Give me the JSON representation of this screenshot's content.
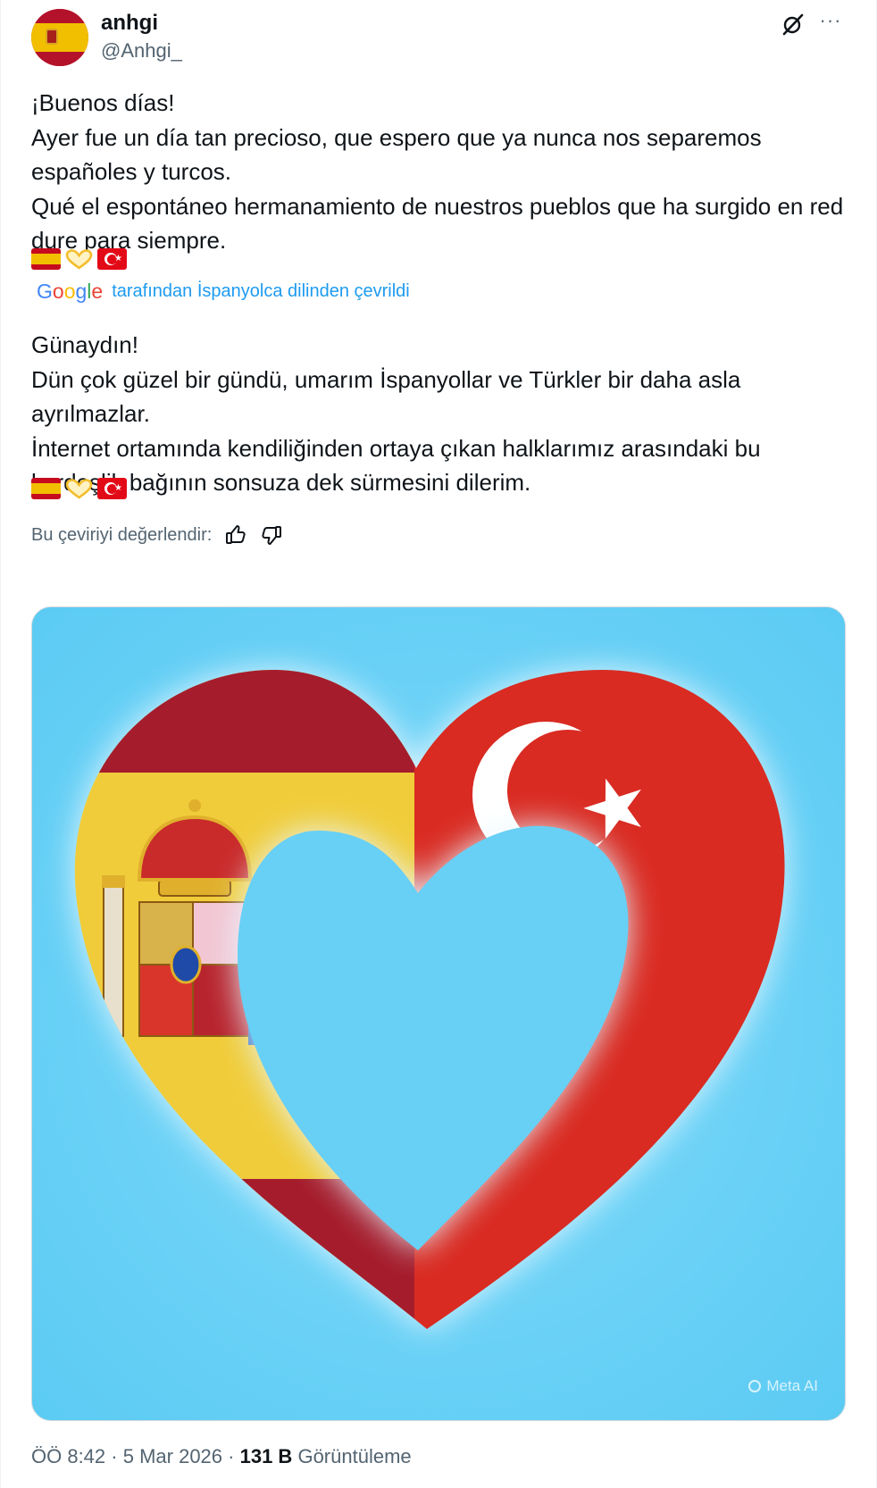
{
  "author": {
    "display_name": "anhgi",
    "handle": "@Anhgi_",
    "avatar_icon": "spain-flag-avatar"
  },
  "header_actions": {
    "grok_icon": "grok-icon",
    "more_icon": "more-options-icon",
    "more_label": "···"
  },
  "original_text": {
    "lines": [
      "¡Buenos días!",
      "Ayer fue un día tan precioso, que espero que ya nunca nos separemos españoles y turcos.",
      "Qué el espontáneo hermanamiento de nuestros pueblos que ha surgido en red dure para siempre."
    ],
    "emojis": [
      "spain-flag-emoji",
      "yellow-heart-hands-emoji",
      "turkey-flag-emoji"
    ]
  },
  "translation": {
    "provider": "Google",
    "notice": "tarafından İspanyolca dilinden çevrildi",
    "lines": [
      "Günaydın!",
      "Dün çok güzel bir gündü, umarım İspanyollar ve Türkler bir daha asla ayrılmazlar.",
      "İnternet ortamında kendiliğinden ortaya çıkan halklarımız arasındaki bu kardeşlik bağının sonsuza dek sürmesini dilerim."
    ]
  },
  "rating": {
    "label": "Bu çeviriyi değerlendir:",
    "thumbs_up_icon": "thumbs-up-icon",
    "thumbs_down_icon": "thumbs-down-icon"
  },
  "media": {
    "description_icon": "spain-turkey-heart-image",
    "watermark": "Meta AI",
    "colors": {
      "sky": "#6dd2f6",
      "spain_red": "#a51d2d",
      "spain_yellow": "#f0cc3a",
      "turkey_red": "#d92b22"
    }
  },
  "footer": {
    "time": "ÖÖ 8:42",
    "sep1": "·",
    "date": "5 Mar 2026",
    "sep2": "·",
    "views_count": "131 B",
    "views_label": "Görüntüleme"
  },
  "colors": {
    "accent": "#1d9bf0",
    "secondary_text": "#536471"
  }
}
